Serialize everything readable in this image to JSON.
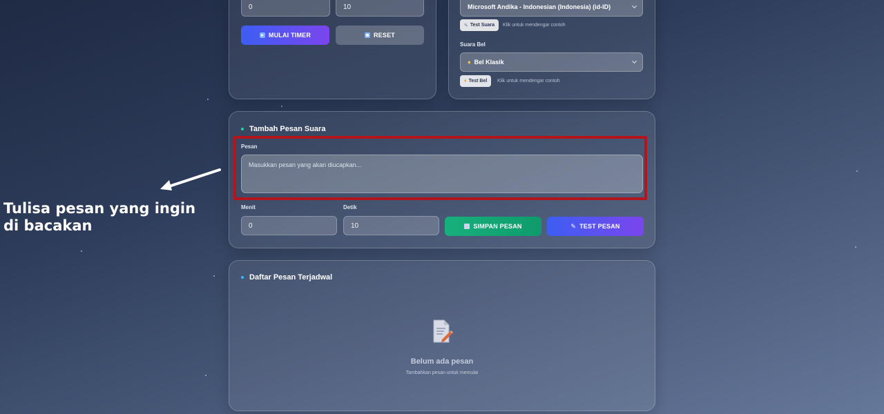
{
  "timer": {
    "minutes_value": "0",
    "seconds_value": "10",
    "start_label": "MULAI TIMER",
    "reset_label": "RESET"
  },
  "voice": {
    "selected_voice": "Microsoft Andika - Indonesian (Indonesia) (id-ID)",
    "test_voice_label": "Test Suara",
    "test_voice_hint": "Klik untuk mendengar contoh",
    "bell_label": "Suara Bel",
    "selected_bell": "Bel Klasik",
    "test_bell_label": "Test Bel",
    "test_bell_hint": "Klik untuk mendengar contoh"
  },
  "add_message": {
    "title": "Tambah Pesan Suara",
    "message_label": "Pesan",
    "message_placeholder": "Masukkan pesan yang akan diucapkan...",
    "minute_label": "Menit",
    "second_label": "Detik",
    "minute_value": "0",
    "second_value": "10",
    "save_label": "SIMPAN PESAN",
    "test_label": "TEST PESAN"
  },
  "schedule": {
    "title": "Daftar Pesan Terjadwal",
    "empty_title": "Belum ada pesan",
    "empty_subtitle": "Tambahkan pesan untuk memulai"
  },
  "annotation": {
    "text": "Tulisa pesan yang ingin di bacakan"
  },
  "colors": {
    "highlight_border": "#b4141c",
    "green_dot": "#2ad1a0",
    "blue_dot": "#3ab8ff"
  }
}
